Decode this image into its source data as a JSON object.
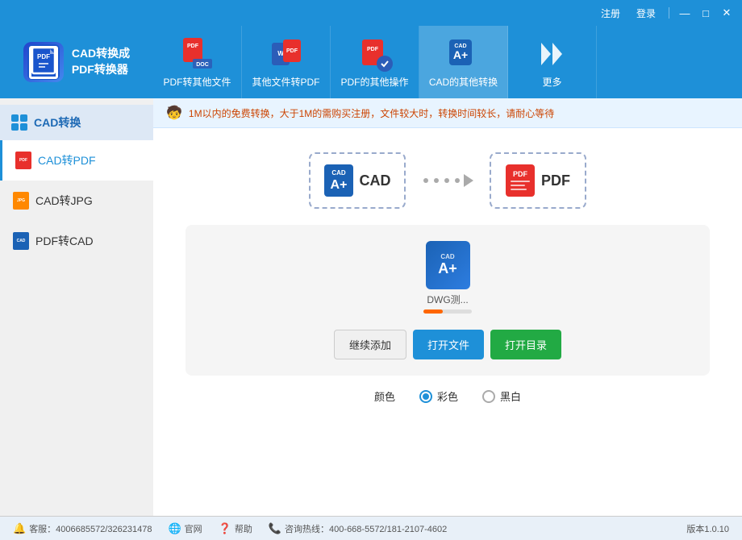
{
  "titlebar": {
    "register": "注册",
    "login": "登录",
    "minimize": "—",
    "maximize": "□",
    "close": "✕"
  },
  "header": {
    "logo_title": "CAD转换成\nPDF转换器",
    "tabs": [
      {
        "label": "PDF转其他文件",
        "id": "tab-pdf-to-other"
      },
      {
        "label": "其他文件转PDF",
        "id": "tab-other-to-pdf"
      },
      {
        "label": "PDF的其他操作",
        "id": "tab-pdf-ops"
      },
      {
        "label": "CAD的其他转换",
        "id": "tab-cad-convert",
        "active": true
      },
      {
        "label": "更多",
        "id": "tab-more"
      }
    ]
  },
  "sidebar": {
    "section_label": "CAD转换",
    "items": [
      {
        "label": "CAD转PDF",
        "id": "cad-to-pdf",
        "active": true
      },
      {
        "label": "CAD转JPG",
        "id": "cad-to-jpg"
      },
      {
        "label": "PDF转CAD",
        "id": "pdf-to-cad"
      }
    ]
  },
  "info_bar": {
    "text": "1M以内的免费转换，大于1M的需购买注册，文件较大时，转换时间较长，请耐心等待"
  },
  "conversion": {
    "from_label": "CAD",
    "to_label": "PDF"
  },
  "drop_area": {
    "file_name": "DWG测...",
    "file_cad_top": "CAD",
    "file_cad_aplus": "A+",
    "buttons": {
      "add": "继续添加",
      "open_file": "打开文件",
      "open_dir": "打开目录"
    }
  },
  "color_options": {
    "label": "颜色",
    "options": [
      {
        "label": "彩色",
        "checked": true
      },
      {
        "label": "黑白",
        "checked": false
      }
    ]
  },
  "footer": {
    "service": "客服：4006685572/326231478",
    "website": "官网",
    "help": "帮助",
    "hotline": "咨询热线：400-668-5572/181-2107-4602",
    "version": "版本1.0.10"
  }
}
